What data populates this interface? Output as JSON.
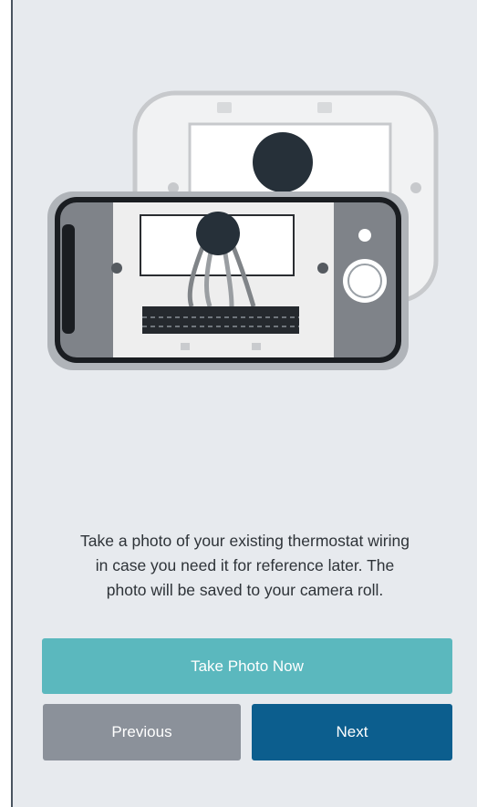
{
  "instructions": {
    "line1": "Take a photo of your existing thermostat wiring",
    "line2": "in case you need it for reference later. The",
    "line3": "photo will be saved to your camera roll."
  },
  "buttons": {
    "take_photo_label": "Take Photo Now",
    "previous_label": "Previous",
    "next_label": "Next"
  },
  "colors": {
    "screen_background": "#e7eaee",
    "take_photo_button": "#5bb8be",
    "previous_button": "#8b919a",
    "next_button": "#0c5e8e"
  },
  "icons": {
    "illustration": "phone-photographing-thermostat-wiring"
  }
}
